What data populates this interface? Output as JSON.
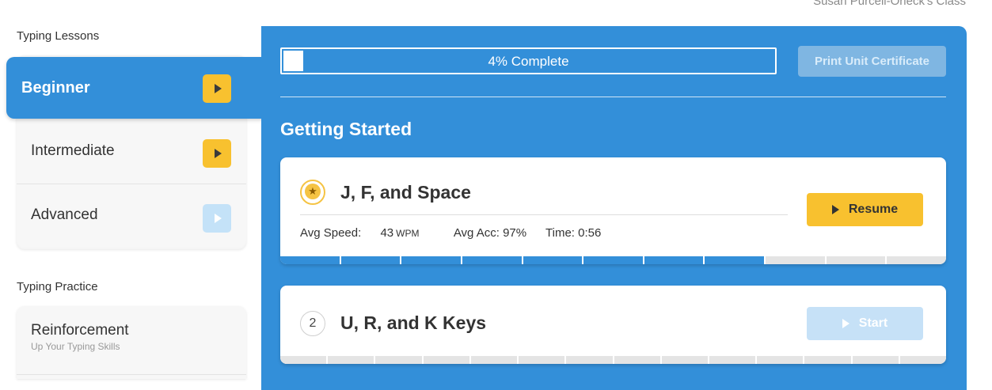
{
  "header": {
    "class_name": "Susan Purcell-Orleck's Class"
  },
  "sidebar": {
    "lessons_title": "Typing Lessons",
    "lessons": [
      {
        "label": "Beginner",
        "state": "active",
        "icon": "play-icon"
      },
      {
        "label": "Intermediate",
        "state": "available",
        "icon": "play-icon"
      },
      {
        "label": "Advanced",
        "state": "disabled",
        "icon": "play-icon"
      }
    ],
    "practice_title": "Typing Practice",
    "practice": [
      {
        "label": "Reinforcement",
        "sublabel": "Up Your Typing Skills"
      }
    ]
  },
  "main": {
    "progress": {
      "label": "4% Complete",
      "percent": 4
    },
    "certificate_button": "Print Unit Certificate",
    "unit_title": "Getting Started",
    "lessons": [
      {
        "badge": "star-icon",
        "title": "J, F, and Space",
        "stats": {
          "speed_label": "Avg Speed:",
          "speed_value": "43",
          "speed_unit": "WPM",
          "acc_label": "Avg Acc:",
          "acc_value": "97%",
          "time_label": "Time:",
          "time_value": "0:56"
        },
        "action": "Resume",
        "segments_total": 11,
        "segments_done": 8
      },
      {
        "badge": "2",
        "title": "U, R, and K Keys",
        "action": "Start",
        "segments_total": 14,
        "segments_done": 0
      }
    ]
  },
  "colors": {
    "primary_blue": "#338fd9",
    "accent_yellow": "#f8c12f",
    "disabled_blue": "#c6e1f7"
  }
}
